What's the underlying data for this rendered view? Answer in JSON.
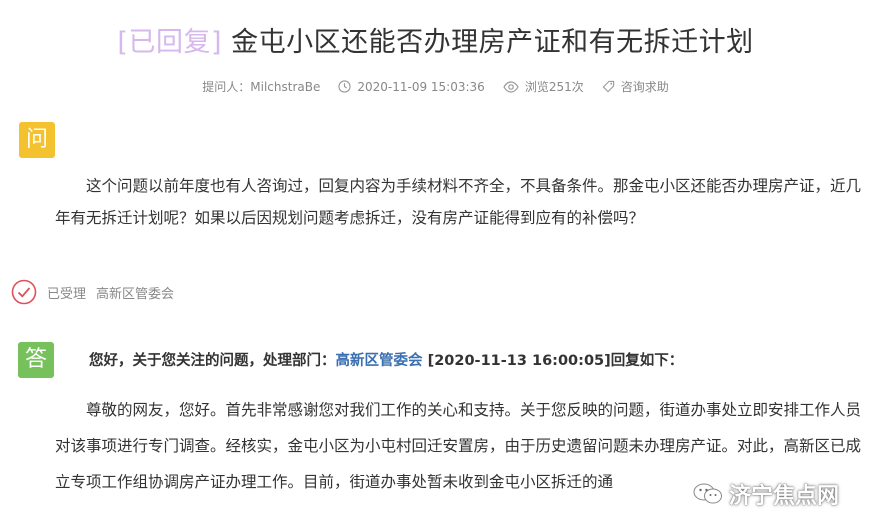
{
  "question": {
    "status_tag": "[已回复]",
    "title": "金屯小区还能否办理房产证和有无拆迁计划",
    "asker": "提问人：MilchstraBe",
    "datetime": "2020-11-09 15:03:36",
    "views": "浏览251次",
    "category": "咨询求助",
    "badge": "问",
    "body": "这个问题以前年度也有人咨询过，回复内容为手续材料不齐全，不具备条件。那金屯小区还能否办理房产证，近几年有无拆迁计划呢？如果以后因规划问题考虑拆迁，没有房产证能得到应有的补偿吗？"
  },
  "status": {
    "state": "已受理",
    "dept": "高新区管委会"
  },
  "answer": {
    "badge": "答",
    "head_prefix": "您好，关于您关注的问题，处理部门：",
    "head_dept": "高新区管委会",
    "head_suffix": "[2020-11-13 16:00:05]回复如下：",
    "body": "尊敬的网友，您好。首先非常感谢您对我们工作的关心和支持。关于您反映的问题，街道办事处立即安排工作人员对该事项进行专门调查。经核实，金屯小区为小屯村回迁安置房，由于历史遗留问题未办理房产证。对此，高新区已成立专项工作组协调房产证办理工作。目前，街道办事处暂未收到金屯小区拆迁的通"
  },
  "watermark": "济宁焦点网",
  "colors": {
    "tag": "#d7b8ee",
    "question_badge": "#f4c22f",
    "answer_badge": "#77c15c",
    "dept_link": "#3a6fb0",
    "status_icon": "#e0505a"
  }
}
